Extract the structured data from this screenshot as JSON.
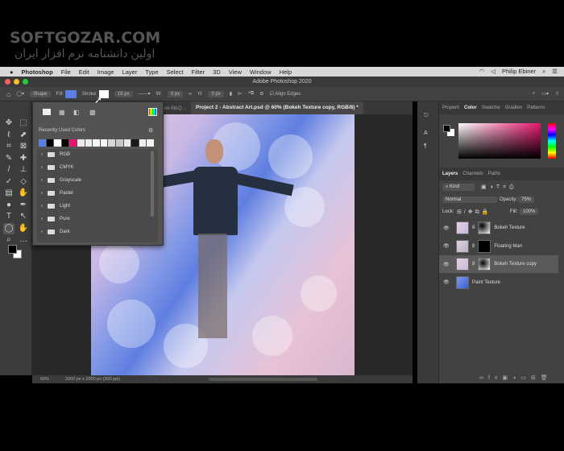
{
  "watermark": {
    "title": "SOFTGOZAR.COM",
    "subtitle": "اولین دانشنامه نرم افزار ایران"
  },
  "menubar": {
    "app": "Photoshop",
    "items": [
      "File",
      "Edit",
      "Image",
      "Layer",
      "Type",
      "Select",
      "Filter",
      "3D",
      "View",
      "Window",
      "Help"
    ],
    "user": "Philip Ebiner"
  },
  "window": {
    "title": "Adobe Photoshop 2020"
  },
  "options": {
    "mode": "Shape",
    "fill_label": "Fill:",
    "fill_color": "#5b7fe0",
    "stroke_label": "Stroke:",
    "stroke_size": "15 px",
    "w_label": "W:",
    "w_value": "0 px",
    "h_label": "H:",
    "h_value": "0 px",
    "align_edges": "Align Edges"
  },
  "tabs": [
    {
      "label": "on-mccutcheon-NkQ..."
    },
    {
      "label": "Project 2 - Abstract Art.psd @ 60% (Bokeh Texture copy, RGB/8) *"
    }
  ],
  "swatch_popup": {
    "recent_label": "Recently Used Colors",
    "recent_colors": [
      "#5b7fe0",
      "#000000",
      "#ffffff",
      "#000000",
      "#e8156f",
      "#f0e6ee",
      "#ececec",
      "#f6f6f6",
      "#f8f8f8",
      "#d8d8d8",
      "#c8c8c8",
      "#e8e8e8",
      "#1a1a1a",
      "#efefef",
      "#f4f4f4"
    ],
    "folders": [
      "RGB",
      "CMYK",
      "Grayscale",
      "Pastel",
      "Light",
      "Pure",
      "Dark"
    ]
  },
  "status": {
    "zoom": "60%",
    "doc_size": "2000 px x 2000 px (300 ppi)"
  },
  "color_panel": {
    "tabs": [
      "Properti",
      "Color",
      "Swatche",
      "Gradien",
      "Patterns"
    ],
    "active": "Color",
    "hue_color": "#e8156f"
  },
  "layers_panel": {
    "tabs": [
      "Layers",
      "Channels",
      "Paths"
    ],
    "filter": "Kind",
    "blend": "Normal",
    "opacity_label": "Opacity:",
    "opacity": "75%",
    "lock_label": "Lock:",
    "fill_label": "Fill:",
    "fill": "100%",
    "layers": [
      {
        "name": "Bokeh Texture",
        "selected": false
      },
      {
        "name": "Floating Man",
        "selected": false
      },
      {
        "name": "Bokeh Texture copy",
        "selected": true
      },
      {
        "name": "Paint Texture",
        "selected": false
      }
    ]
  }
}
